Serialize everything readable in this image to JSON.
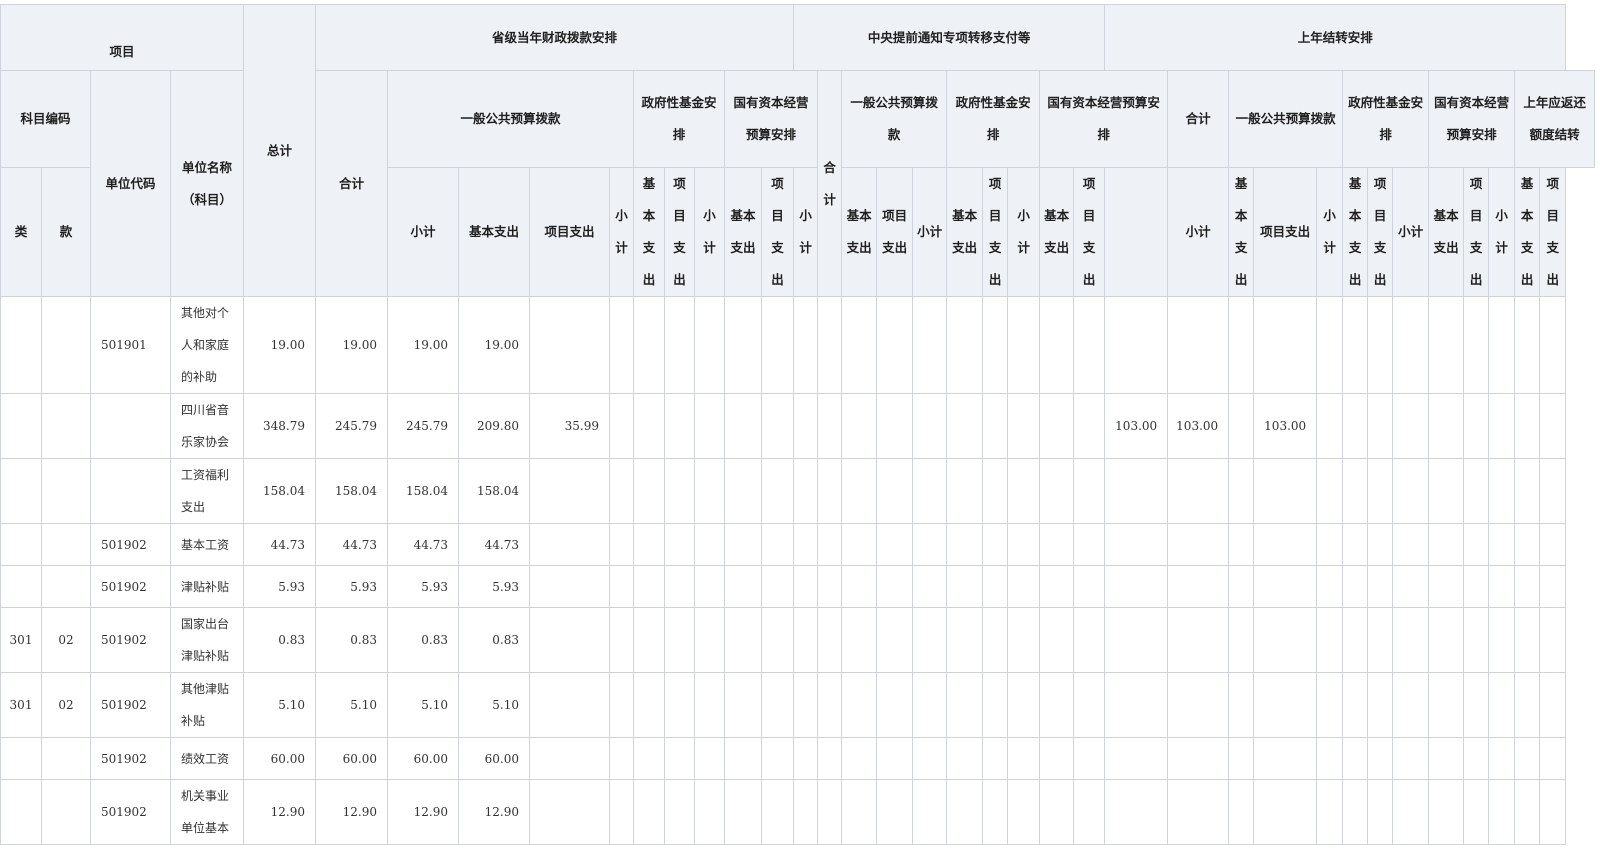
{
  "header": {
    "project": "项目",
    "subject_code": "科目编码",
    "category": "类",
    "item": "款",
    "unit_code": "单位代码",
    "unit_name": "单位名称（科目）",
    "total": "总计",
    "provincial_group": "省级当年财政拨款安排",
    "central_group": "中央提前通知专项转移支付等",
    "carryover_group": "上年结转安排",
    "heji": "合计",
    "general_public": "一般公共预算拨款",
    "gov_fund": "政府性基金安排",
    "state_capital": "国有资本经营预算安排",
    "c_general_public": "一般公共预算拨款",
    "c_gov_fund": "政府性基金安排",
    "c_state_capital": "国有资本经营预算安排",
    "k_general_public": "一般公共预算拨款",
    "k_gov_fund": "政府性基金安排",
    "k_state_capital": "国有资本经营预算安排",
    "k_repay": "上年应返还额度结转",
    "subtotal": "小计",
    "basic_exp": "基本支出",
    "project_exp": "项目支出"
  },
  "rows": [
    {
      "lei": "",
      "kuan": "",
      "code": "501901",
      "name": "其他对个人和家庭的补助",
      "total": "19.00",
      "heji": "19.00",
      "xiaoji": "19.00",
      "basic": "19.00",
      "project": "",
      "k_heji": "",
      "k_xiaoji": "",
      "k_project": ""
    },
    {
      "lei": "",
      "kuan": "",
      "code": "",
      "name": "四川省音乐家协会",
      "total": "348.79",
      "heji": "245.79",
      "xiaoji": "245.79",
      "basic": "209.80",
      "project": "35.99",
      "k_heji": "103.00",
      "k_xiaoji": "103.00",
      "k_project": "103.00"
    },
    {
      "lei": "",
      "kuan": "",
      "code": "",
      "name": "工资福利支出",
      "total": "158.04",
      "heji": "158.04",
      "xiaoji": "158.04",
      "basic": "158.04",
      "project": "",
      "k_heji": "",
      "k_xiaoji": "",
      "k_project": ""
    },
    {
      "lei": "",
      "kuan": "",
      "code": "501902",
      "name": "基本工资",
      "total": "44.73",
      "heji": "44.73",
      "xiaoji": "44.73",
      "basic": "44.73",
      "project": "",
      "k_heji": "",
      "k_xiaoji": "",
      "k_project": ""
    },
    {
      "lei": "",
      "kuan": "",
      "code": "501902",
      "name": "津贴补贴",
      "total": "5.93",
      "heji": "5.93",
      "xiaoji": "5.93",
      "basic": "5.93",
      "project": "",
      "k_heji": "",
      "k_xiaoji": "",
      "k_project": ""
    },
    {
      "lei": "301",
      "kuan": "02",
      "code": "501902",
      "name": "国家出台津贴补贴",
      "total": "0.83",
      "heji": "0.83",
      "xiaoji": "0.83",
      "basic": "0.83",
      "project": "",
      "k_heji": "",
      "k_xiaoji": "",
      "k_project": ""
    },
    {
      "lei": "301",
      "kuan": "02",
      "code": "501902",
      "name": "其他津贴补贴",
      "total": "5.10",
      "heji": "5.10",
      "xiaoji": "5.10",
      "basic": "5.10",
      "project": "",
      "k_heji": "",
      "k_xiaoji": "",
      "k_project": ""
    },
    {
      "lei": "",
      "kuan": "",
      "code": "501902",
      "name": "绩效工资",
      "total": "60.00",
      "heji": "60.00",
      "xiaoji": "60.00",
      "basic": "60.00",
      "project": "",
      "k_heji": "",
      "k_xiaoji": "",
      "k_project": ""
    },
    {
      "lei": "",
      "kuan": "",
      "code": "501902",
      "name": "机关事业单位基本",
      "total": "12.90",
      "heji": "12.90",
      "xiaoji": "12.90",
      "basic": "12.90",
      "project": "",
      "k_heji": "",
      "k_xiaoji": "",
      "k_project": ""
    }
  ]
}
